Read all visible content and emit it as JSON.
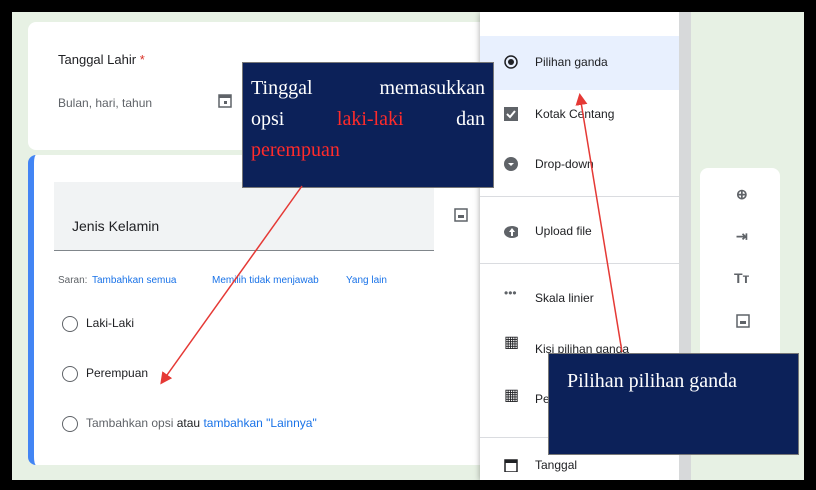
{
  "form": {
    "birthdate_label": "Tanggal Lahir",
    "required_mark": "*",
    "date_placeholder": "Bulan, hari, tahun",
    "question_title": "Jenis Kelamin",
    "suggestions_label": "Saran:",
    "suggestions": [
      "Tambahkan semua",
      "Memilih tidak menjawab",
      "Yang lain"
    ],
    "options": [
      "Laki-Laki",
      "Perempuan"
    ],
    "add_option": "Tambahkan opsi",
    "or_text": "atau",
    "add_other": "tambahkan \"Lainnya\""
  },
  "menu": {
    "items": [
      "Pilihan ganda",
      "Kotak Centang",
      "Drop-down",
      "Upload file",
      "Skala linier",
      "Kisi pilihan ganda",
      "Pe",
      "Tanggal"
    ]
  },
  "annotations": {
    "note1_words": [
      "Tinggal",
      "memasukkan",
      "opsi",
      "laki-laki",
      "dan",
      "perempuan"
    ],
    "note2": "Pilihan pilihan ganda"
  },
  "sidebar_icons": [
    "add-icon",
    "import-icon",
    "text-icon",
    "image-icon"
  ]
}
